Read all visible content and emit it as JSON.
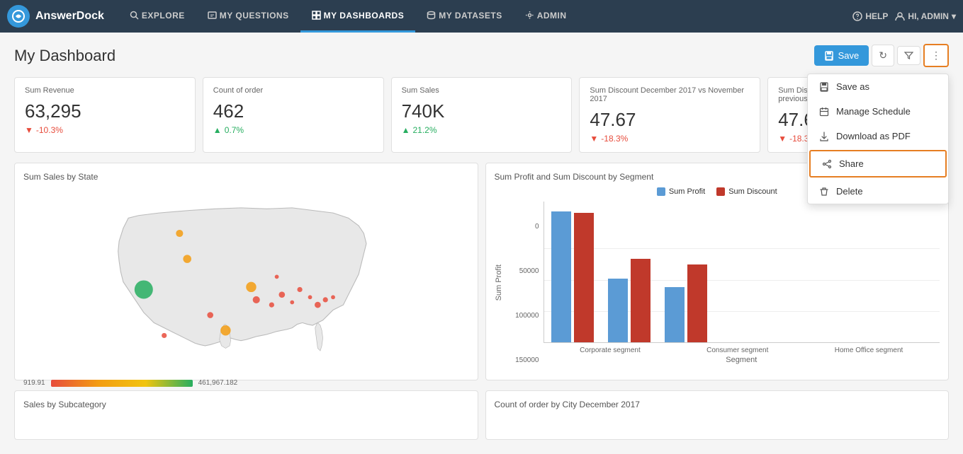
{
  "app": {
    "logo_text": "AnswerDock",
    "nav_items": [
      {
        "label": "EXPLORE",
        "active": false
      },
      {
        "label": "MY QUESTIONS",
        "active": false
      },
      {
        "label": "MY DASHBOARDS",
        "active": true
      },
      {
        "label": "MY DATASETS",
        "active": false
      },
      {
        "label": "ADMIN",
        "active": false
      }
    ],
    "nav_right": [
      {
        "label": "HELP"
      },
      {
        "label": "Hi, Admin"
      }
    ]
  },
  "page": {
    "title": "My Dashboard",
    "toolbar": {
      "save_label": "Save",
      "refresh_icon": "↻",
      "filter_icon": "▼",
      "more_icon": "⋮"
    },
    "dropdown": {
      "items": [
        {
          "label": "Save as",
          "icon": "save"
        },
        {
          "label": "Manage Schedule",
          "icon": "calendar"
        },
        {
          "label": "Download as PDF",
          "icon": "download"
        },
        {
          "label": "Share",
          "icon": "share",
          "highlighted": true
        },
        {
          "label": "Delete",
          "icon": "trash"
        }
      ]
    }
  },
  "kpis": [
    {
      "label": "Sum Revenue",
      "value": "63,295",
      "change": "-10.3%",
      "positive": false
    },
    {
      "label": "Count of order",
      "value": "462",
      "change": "0.7%",
      "positive": true
    },
    {
      "label": "Sum Sales",
      "value": "740K",
      "change": "21.2%",
      "positive": true
    },
    {
      "label": "Sum Discount December 2017 vs November 2017",
      "value": "47.67",
      "change": "-18.3%",
      "positive": false
    },
    {
      "label": "Sum Discount December 2017 compared to previous",
      "value": "47.67",
      "change": "-18.3%",
      "positive": false
    }
  ],
  "map_card": {
    "title": "Sum Sales by State",
    "color_min": "919.91",
    "color_max": "461,967.182"
  },
  "bar_chart": {
    "title": "Sum Profit and Sum Discount by Segment",
    "legend": [
      {
        "label": "Sum Profit",
        "color": "#5b9bd5"
      },
      {
        "label": "Sum Discount",
        "color": "#c0392b"
      }
    ],
    "y_axis_title": "Sum Profit",
    "x_axis_title": "Segment",
    "y_labels": [
      "150000",
      "100000",
      "50000",
      "0"
    ],
    "groups": [
      {
        "label": "Corporate segment",
        "blue_height": 185,
        "red_height": 183
      },
      {
        "label": "Consumer segment",
        "blue_height": 90,
        "red_height": 118
      },
      {
        "label": "Home Office segment",
        "blue_height": 78,
        "red_height": 110
      }
    ]
  },
  "bottom_cards": [
    {
      "title": "Sales by Subcategory"
    },
    {
      "title": "Count of order by City December 2017"
    }
  ]
}
